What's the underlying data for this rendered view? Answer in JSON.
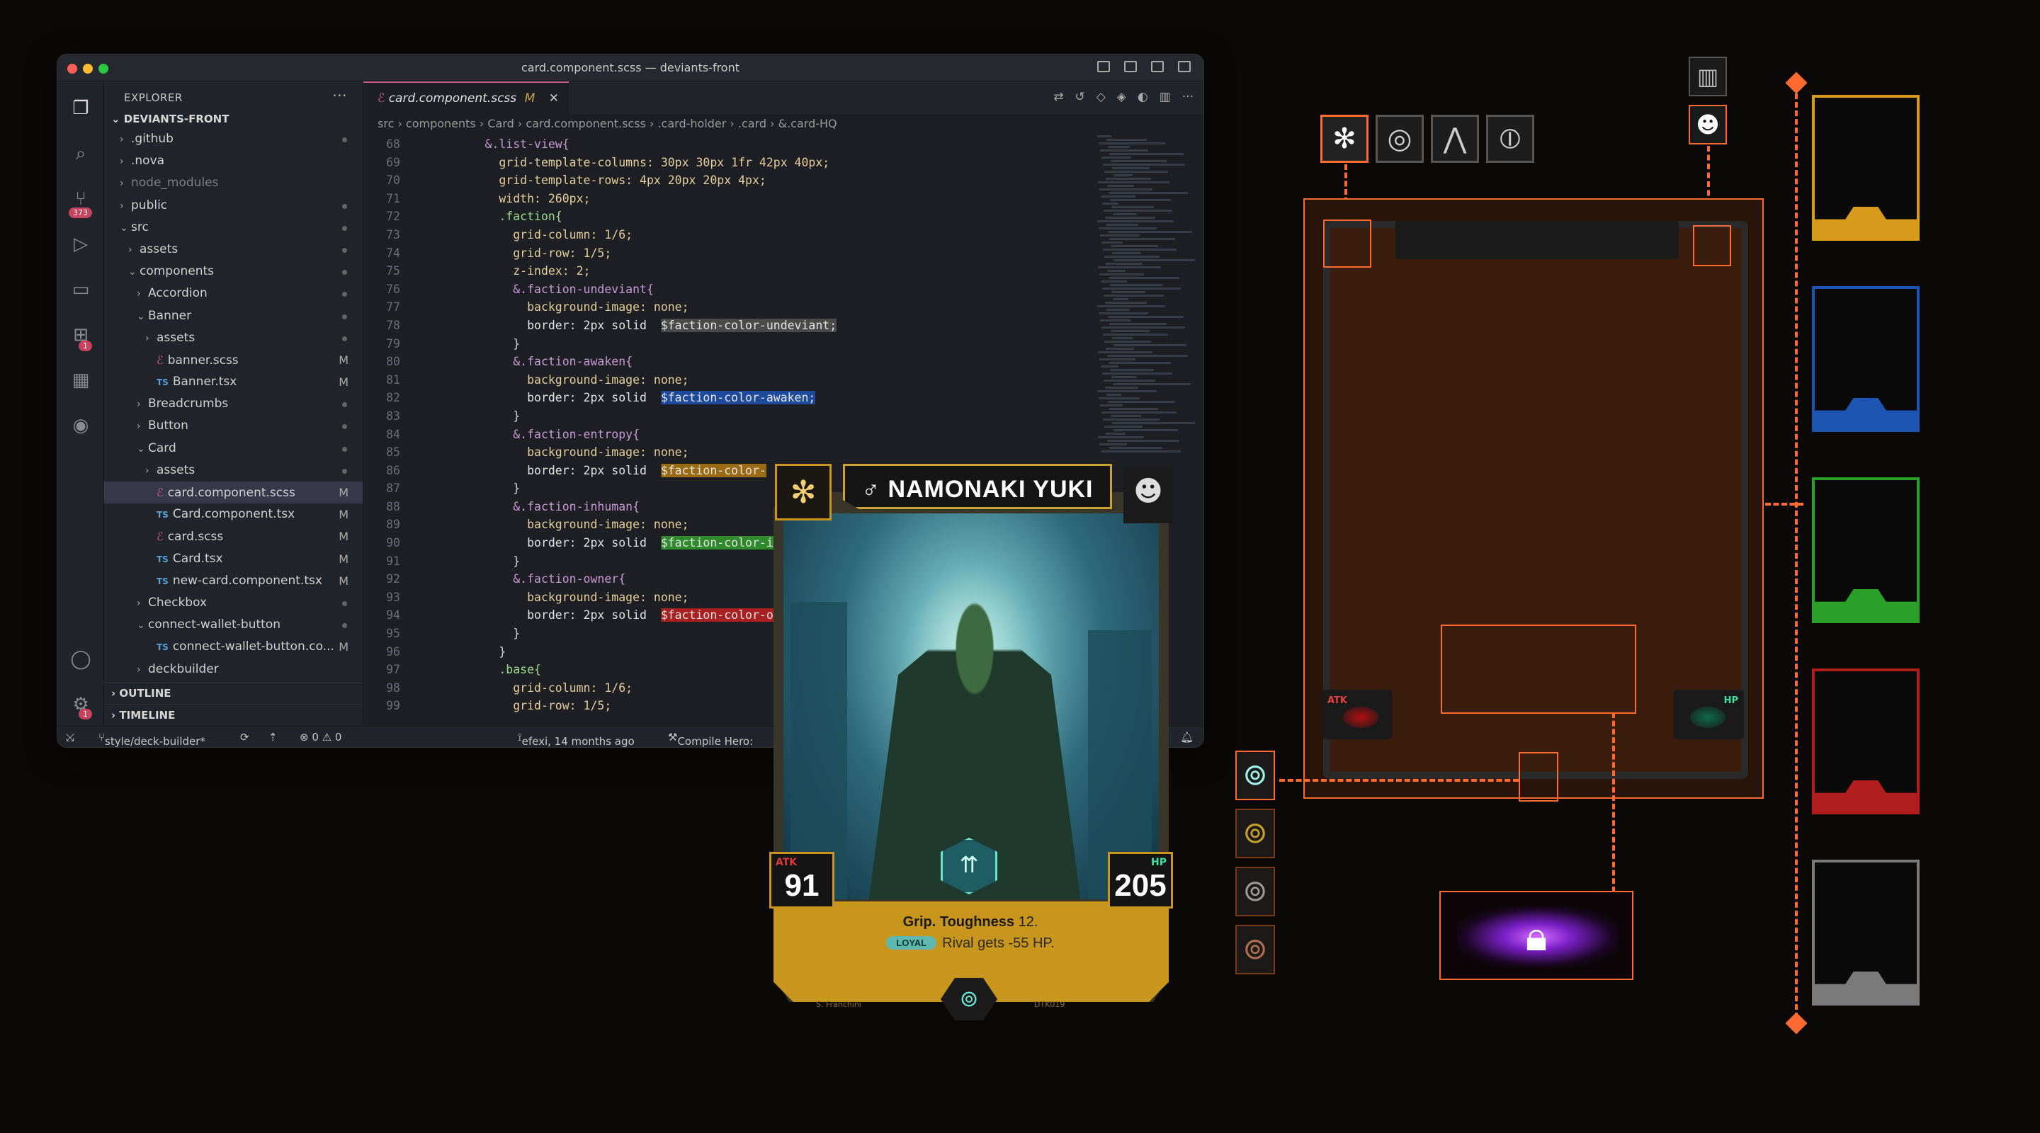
{
  "window": {
    "title": "card.component.scss — deviants-front"
  },
  "activity": {
    "scm_badge": "373",
    "ext_badge": "1",
    "settings_badge": "1"
  },
  "explorer": {
    "heading": "EXPLORER",
    "more": "···",
    "root": "DEVIANTS-FRONT",
    "items": [
      {
        "indent": 1,
        "chev": "›",
        "label": ".github",
        "mark": "dot",
        "icon": ""
      },
      {
        "indent": 1,
        "chev": "›",
        "label": ".nova",
        "mark": "",
        "icon": ""
      },
      {
        "indent": 1,
        "chev": "›",
        "label": "node_modules",
        "mark": "",
        "icon": "",
        "dim": true
      },
      {
        "indent": 1,
        "chev": "›",
        "label": "public",
        "mark": "dot",
        "icon": ""
      },
      {
        "indent": 1,
        "chev": "⌄",
        "label": "src",
        "mark": "dot",
        "icon": ""
      },
      {
        "indent": 2,
        "chev": "›",
        "label": "assets",
        "mark": "dot",
        "icon": ""
      },
      {
        "indent": 2,
        "chev": "⌄",
        "label": "components",
        "mark": "dot",
        "icon": ""
      },
      {
        "indent": 3,
        "chev": "›",
        "label": "Accordion",
        "mark": "dot",
        "icon": ""
      },
      {
        "indent": 3,
        "chev": "⌄",
        "label": "Banner",
        "mark": "dot",
        "icon": ""
      },
      {
        "indent": 4,
        "chev": "›",
        "label": "assets",
        "mark": "dot",
        "icon": ""
      },
      {
        "indent": 4,
        "chev": "",
        "label": "banner.scss",
        "mark": "M",
        "icon": "scss"
      },
      {
        "indent": 4,
        "chev": "",
        "label": "Banner.tsx",
        "mark": "M",
        "icon": "ts"
      },
      {
        "indent": 3,
        "chev": "›",
        "label": "Breadcrumbs",
        "mark": "dot",
        "icon": ""
      },
      {
        "indent": 3,
        "chev": "›",
        "label": "Button",
        "mark": "dot",
        "icon": ""
      },
      {
        "indent": 3,
        "chev": "⌄",
        "label": "Card",
        "mark": "dot",
        "icon": ""
      },
      {
        "indent": 4,
        "chev": "›",
        "label": "assets",
        "mark": "dot",
        "icon": ""
      },
      {
        "indent": 4,
        "chev": "",
        "label": "card.component.scss",
        "mark": "M",
        "icon": "scss",
        "selected": true
      },
      {
        "indent": 4,
        "chev": "",
        "label": "Card.component.tsx",
        "mark": "M",
        "icon": "ts"
      },
      {
        "indent": 4,
        "chev": "",
        "label": "card.scss",
        "mark": "M",
        "icon": "scss"
      },
      {
        "indent": 4,
        "chev": "",
        "label": "Card.tsx",
        "mark": "M",
        "icon": "ts"
      },
      {
        "indent": 4,
        "chev": "",
        "label": "new-card.component.tsx",
        "mark": "M",
        "icon": "ts"
      },
      {
        "indent": 3,
        "chev": "›",
        "label": "Checkbox",
        "mark": "dot",
        "icon": ""
      },
      {
        "indent": 3,
        "chev": "⌄",
        "label": "connect-wallet-button",
        "mark": "dot",
        "icon": ""
      },
      {
        "indent": 4,
        "chev": "",
        "label": "connect-wallet-button.co...",
        "mark": "M",
        "icon": "ts"
      },
      {
        "indent": 3,
        "chev": "›",
        "label": "deckbuilder",
        "mark": "",
        "icon": ""
      }
    ],
    "outline": "OUTLINE",
    "timeline": "TIMELINE"
  },
  "editor": {
    "tab_label": "card.component.scss",
    "tab_mark": "M",
    "breadcrumb": "src  ›  components  ›  Card  ›  card.component.scss  ›  .card-holder  ›  .card  ›  &.card-HQ",
    "lines": [
      {
        "n": "68",
        "t": "        &.list-view{"
      },
      {
        "n": "69",
        "t": "          grid-template-columns: 30px 30px 1fr 42px 40px;"
      },
      {
        "n": "70",
        "t": "          grid-template-rows: 4px 20px 20px 4px;"
      },
      {
        "n": "71",
        "t": "          width: 260px;"
      },
      {
        "n": "72",
        "t": "          .faction{"
      },
      {
        "n": "73",
        "t": "            grid-column: 1/6;"
      },
      {
        "n": "74",
        "t": "            grid-row: 1/5;"
      },
      {
        "n": "75",
        "t": "            z-index: 2;"
      },
      {
        "n": "76",
        "t": "            &.faction-undeviant{"
      },
      {
        "n": "77",
        "t": "              background-image: none;"
      },
      {
        "n": "78",
        "t": "              border: 2px solid  $faction-color-undeviant;",
        "hl": "#4a4a4a"
      },
      {
        "n": "79",
        "t": "            }"
      },
      {
        "n": "80",
        "t": "            &.faction-awaken{"
      },
      {
        "n": "81",
        "t": "              background-image: none;"
      },
      {
        "n": "82",
        "t": "              border: 2px solid  $faction-color-awaken;",
        "hl": "#1d4a9a"
      },
      {
        "n": "83",
        "t": "            }"
      },
      {
        "n": "84",
        "t": "            &.faction-entropy{"
      },
      {
        "n": "85",
        "t": "              background-image: none;"
      },
      {
        "n": "86",
        "t": "              border: 2px solid  $faction-color-",
        "hl": "#9a6b12"
      },
      {
        "n": "87",
        "t": "            }"
      },
      {
        "n": "88",
        "t": "            &.faction-inhuman{"
      },
      {
        "n": "89",
        "t": "              background-image: none;"
      },
      {
        "n": "90",
        "t": "              border: 2px solid  $faction-color-i",
        "hl": "#2f8a2c"
      },
      {
        "n": "91",
        "t": "            }"
      },
      {
        "n": "92",
        "t": "            &.faction-owner{"
      },
      {
        "n": "93",
        "t": "              background-image: none;"
      },
      {
        "n": "94",
        "t": "              border: 2px solid  $faction-color-o",
        "hl": "#a82020"
      },
      {
        "n": "95",
        "t": "            }"
      },
      {
        "n": "96",
        "t": "          }"
      },
      {
        "n": "97",
        "t": "          .base{"
      },
      {
        "n": "98",
        "t": "            grid-column: 1/6;"
      },
      {
        "n": "99",
        "t": "            grid-row: 1/5;"
      }
    ]
  },
  "statusbar": {
    "branch": "style/deck-builder*",
    "problems": "⊗ 0 ⚠ 0",
    "blame": "efexi, 14 months ago",
    "compile": "Compile Hero: "
  },
  "card": {
    "name": "♂ NAMONAKI YUKI",
    "atk_label": "ATK",
    "atk": "91",
    "hp_label": "HP",
    "hp": "205",
    "ability_bold": "Grip. Toughness",
    "ability_value": " 12.",
    "loyal": "LOYAL",
    "rule": "Rival gets -55 HP.",
    "artist": "S. Franchini",
    "code": "DTK019"
  },
  "board": {
    "atk_label": "ATK",
    "hp_label": "HP"
  },
  "colors": {
    "accent": "#ff6a30",
    "card_gold": "#c8961c",
    "slot_colors": [
      "#d89a1a",
      "#1e55b4",
      "#2aa028",
      "#b11d1d",
      "#7a7a7a"
    ]
  }
}
